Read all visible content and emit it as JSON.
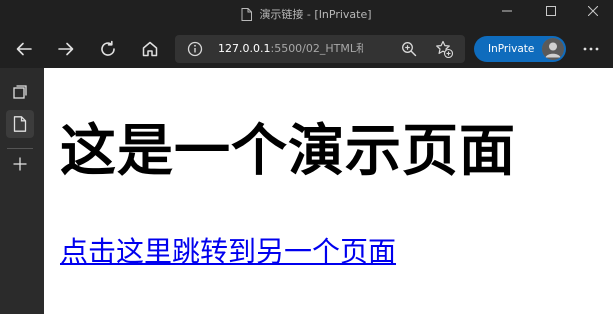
{
  "window": {
    "title": "演示链接 - [InPrivate]"
  },
  "toolbar": {
    "url_host": "127.0.0.1",
    "url_path": ":5500/02_HTML和...",
    "inprivate_label": "InPrivate"
  },
  "page": {
    "heading": "这是一个演示页面",
    "link_text": "点击这里跳转到另一个页面"
  },
  "colors": {
    "chrome_bg": "#202020",
    "address_bg": "#333333",
    "inprivate_bg": "#0f6cbd",
    "sidebar_bg": "#2b2b2b",
    "link": "#0000ee"
  },
  "icons": {
    "back": "back-arrow-icon",
    "forward": "forward-arrow-icon",
    "refresh": "refresh-icon",
    "home": "home-icon",
    "site_info": "info-icon",
    "zoom": "zoom-icon",
    "favorites": "add-favorite-icon",
    "more": "more-icon",
    "tab_actions": "tab-actions-icon",
    "vertical_tab": "page-tab-icon",
    "new_tab": "plus-icon"
  }
}
